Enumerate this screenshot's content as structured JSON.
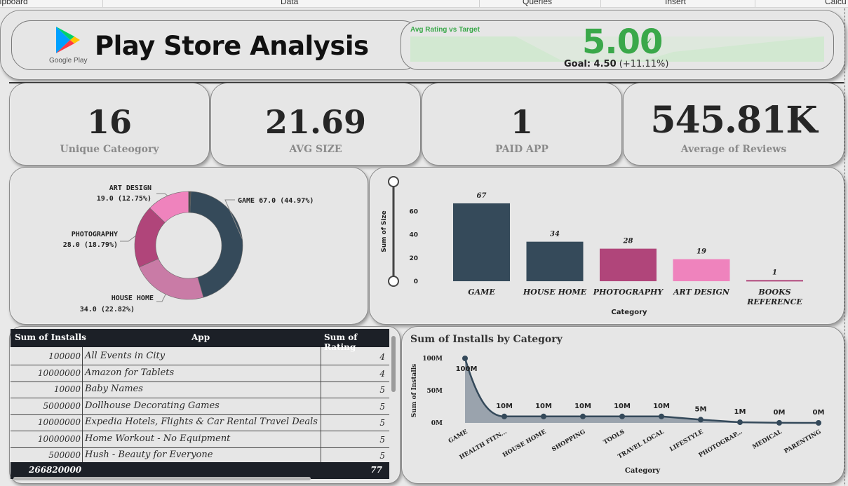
{
  "ribbon": {
    "groups": [
      "lipboard",
      "Data",
      "Queries",
      "Insert",
      "Calcu"
    ]
  },
  "header": {
    "logo_label": "Google Play",
    "title": "Play Store Analysis",
    "kpi_gauge": {
      "caption": "Avg Rating vs Target",
      "value": "5.00",
      "goal_label": "Goal: 4.50",
      "goal_delta": "(+11.11%)",
      "status_color": "#3aa84a"
    }
  },
  "kpis": [
    {
      "value": "16",
      "label": "Unique Cateogory"
    },
    {
      "value": "21.69",
      "label": "AVG SIZE"
    },
    {
      "value": "1",
      "label": "PAID APP"
    },
    {
      "value": "545.81K",
      "label": "Average of Reviews"
    }
  ],
  "colors": {
    "dark_slate": "#354a5a",
    "magenta": "#b0457a",
    "pink_light": "#c97ba6",
    "pink": "#ef83bd"
  },
  "chart_data": [
    {
      "type": "pie",
      "variant": "donut",
      "slices": [
        {
          "label": "GAME",
          "value": 67.0,
          "pct": "44.97%",
          "color": "#354a5a",
          "text": "GAME 67.0 (44.97%)"
        },
        {
          "label": "HOUSE HOME",
          "value": 34.0,
          "pct": "22.82%",
          "color": "#c97ba6",
          "text": "34.0 (22.82%)"
        },
        {
          "label": "PHOTOGRAPHY",
          "value": 28.0,
          "pct": "18.79%",
          "color": "#b0457a",
          "text": "28.0 (18.79%)"
        },
        {
          "label": "ART DESIGN",
          "value": 19.0,
          "pct": "12.75%",
          "color": "#ef83bd",
          "text": "19.0 (12.75%)"
        },
        {
          "label": "",
          "value": 1.0,
          "pct": "",
          "color": "#4a4a4a",
          "text": ""
        }
      ]
    },
    {
      "type": "bar",
      "categories": [
        "GAME",
        "HOUSE HOME",
        "PHOTOGRAPHY",
        "ART DESIGN",
        "BOOKS REFERENCE"
      ],
      "category_lines": [
        [
          "GAME"
        ],
        [
          "HOUSE HOME"
        ],
        [
          "PHOTOGRAPHY"
        ],
        [
          "ART DESIGN"
        ],
        [
          "BOOKS",
          "REFERENCE"
        ]
      ],
      "values": [
        67,
        34,
        28,
        19,
        1
      ],
      "colors": [
        "#354a5a",
        "#354a5a",
        "#b0457a",
        "#ef83bd",
        "#b0457a"
      ],
      "xlabel": "Category",
      "ylabel": "Sum of Size",
      "yticks": [
        0,
        20,
        40,
        60
      ],
      "ylim": [
        0,
        70
      ],
      "grid": false
    },
    {
      "type": "area",
      "title": "Sum of Installs by Category",
      "categories": [
        "GAME",
        "HEALTH FITN...",
        "HOUSE HOME",
        "SHOPPING",
        "TOOLS",
        "TRAVEL LOCAL",
        "LIFESTYLE",
        "PHOTOGRAP...",
        "MEDICAL",
        "PARENTING"
      ],
      "values": [
        100000000,
        10000000,
        10000000,
        10000000,
        10000000,
        10000000,
        5000000,
        1000000,
        100000,
        10000
      ],
      "data_labels": [
        "100M",
        "10M",
        "10M",
        "10M",
        "10M",
        "10M",
        "5M",
        "1M",
        "0M",
        "0M"
      ],
      "yticks": [
        "0M",
        "50M",
        "100M"
      ],
      "ytick_values": [
        0,
        50000000,
        100000000
      ],
      "xlabel": "Category",
      "ylabel": "Sum of Installs",
      "ylim": [
        0,
        100000000
      ],
      "grid": false
    }
  ],
  "table": {
    "headers": [
      "Sum of Installs",
      "App",
      "Sum of Rating"
    ],
    "rows": [
      {
        "installs": "100000",
        "app": "All Events in City",
        "rating": "4"
      },
      {
        "installs": "10000000",
        "app": "Amazon for Tablets",
        "rating": "4"
      },
      {
        "installs": "10000",
        "app": "Baby Names",
        "rating": "5"
      },
      {
        "installs": "5000000",
        "app": "Dollhouse Decorating Games",
        "rating": "5"
      },
      {
        "installs": "10000000",
        "app": "Expedia Hotels, Flights & Car Rental Travel Deals",
        "rating": "5"
      },
      {
        "installs": "10000000",
        "app": "Home Workout - No Equipment",
        "rating": "5"
      },
      {
        "installs": "500000",
        "app": "Hush - Beauty for Everyone",
        "rating": "5"
      }
    ],
    "total": {
      "installs": "266820000",
      "rating": "77"
    }
  }
}
